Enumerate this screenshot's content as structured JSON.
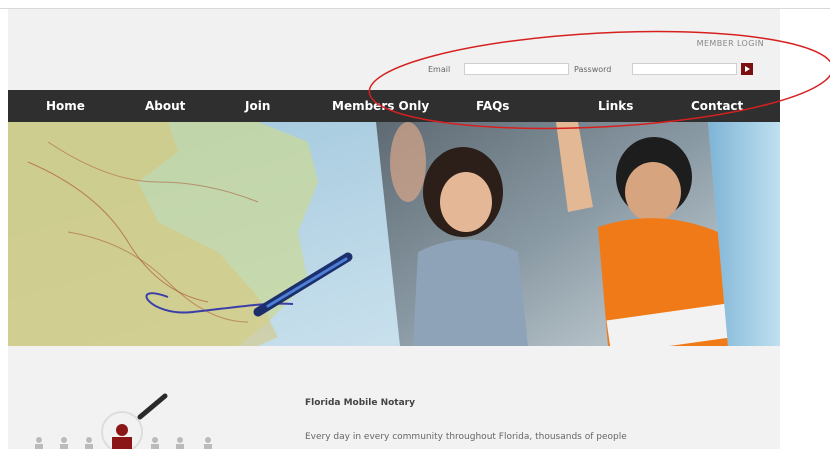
{
  "login": {
    "title": "MEMBER LOGIN",
    "email_label": "Email",
    "email_value": "",
    "password_label": "Password",
    "password_value": ""
  },
  "nav": [
    {
      "label": "Home"
    },
    {
      "label": "About"
    },
    {
      "label": "Join"
    },
    {
      "label": "Members Only"
    },
    {
      "label": "FAQs"
    },
    {
      "label": "Links"
    },
    {
      "label": "Contact"
    }
  ],
  "content": {
    "headline": "Florida Mobile Notary",
    "paragraph": "Every day in every community throughout Florida, thousands of people"
  },
  "colors": {
    "nav_bg": "#2f2f2f",
    "accent": "#7a1010",
    "annotation": "#d62020"
  }
}
